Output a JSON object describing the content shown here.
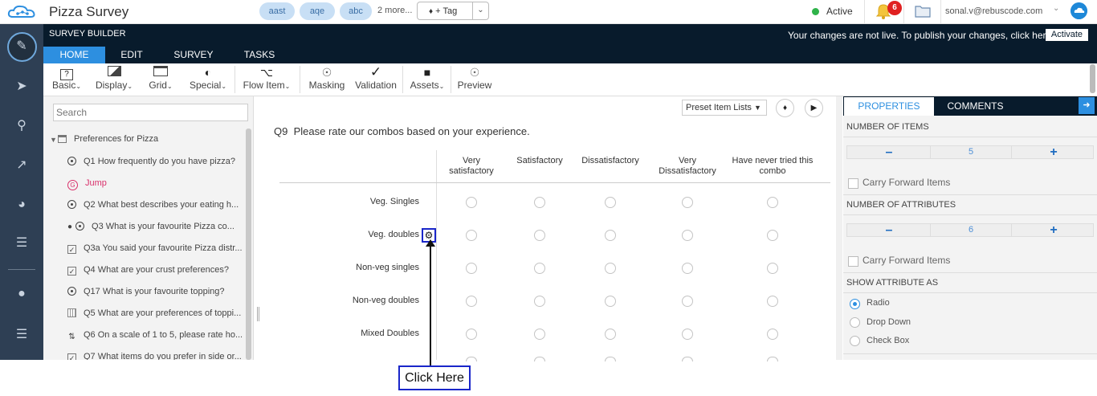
{
  "app": {
    "title": "Pizza Survey"
  },
  "tags": [
    "aast",
    "aqe",
    "abc"
  ],
  "more_tags": "2 more...",
  "add_tag": "+ Tag",
  "status": "Active",
  "notifications": "6",
  "user_email": "sonal.v@rebuscode.com",
  "builder": {
    "title": "SURVEY BUILDER",
    "live_message": "Your changes are not live. To publish your changes, click here",
    "activate": "Activate",
    "tabs": [
      "HOME",
      "EDIT",
      "SURVEY",
      "TASKS"
    ]
  },
  "toolbar": {
    "basic": "Basic",
    "display": "Display",
    "grid": "Grid",
    "special": "Special",
    "flow_item": "Flow Item",
    "masking": "Masking",
    "validation": "Validation",
    "assets": "Assets",
    "preview": "Preview"
  },
  "left_panel": {
    "search_placeholder": "Search",
    "root": "Preferences for Pizza",
    "items": [
      {
        "label": "Q1 How frequently do you have pizza?",
        "icon": "radio-icon"
      },
      {
        "label": "Jump",
        "icon": "jump-icon"
      },
      {
        "label": "Q2 What best describes your eating h...",
        "icon": "radio-icon"
      },
      {
        "label": "Q3 What is your favourite Pizza co...",
        "icon": "radio-icon"
      },
      {
        "label": "Q3a You said your favourite Pizza distr...",
        "icon": "checkbox-icon"
      },
      {
        "label": "Q4 What are your crust preferences?",
        "icon": "checkbox-icon"
      },
      {
        "label": "Q17 What is your favourite topping?",
        "icon": "radio-icon"
      },
      {
        "label": "Q5 What are your preferences of toppi...",
        "icon": "grid-icon"
      },
      {
        "label": "Q6 On a scale of 1 to 5, please rate ho...",
        "icon": "slider-icon"
      },
      {
        "label": "Q7 What items do you prefer in side or...",
        "icon": "checkbox-icon"
      }
    ]
  },
  "center": {
    "preset": "Preset Item Lists",
    "question_number": "Q9",
    "question_text": "Please rate our combos based on your experience.",
    "columns": [
      "Very satisfactory",
      "Satisfactory",
      "Dissatisfactory",
      "Very Dissatisfactory",
      "Have never tried this combo"
    ],
    "rows": [
      "Veg. Singles",
      "Veg. doubles",
      "Non-veg singles",
      "Non-veg doubles",
      "Mixed Doubles"
    ],
    "callout": "Click Here"
  },
  "right_panel": {
    "tabs": [
      "PROPERTIES",
      "COMMENTS"
    ],
    "num_items_label": "NUMBER OF ITEMS",
    "num_items": "5",
    "carry_forward_1": "Carry Forward Items",
    "num_attributes_label": "NUMBER OF ATTRIBUTES",
    "num_attributes": "6",
    "carry_forward_2": "Carry Forward Items",
    "show_attribute_as": "SHOW ATTRIBUTE AS",
    "options": [
      "Radio",
      "Drop Down",
      "Check Box"
    ],
    "selected_option": "Radio"
  },
  "colors": {
    "accent": "#2d8fe0",
    "dark": "#081b2c",
    "rail": "#2e3f54",
    "callout": "#1a26c9"
  }
}
